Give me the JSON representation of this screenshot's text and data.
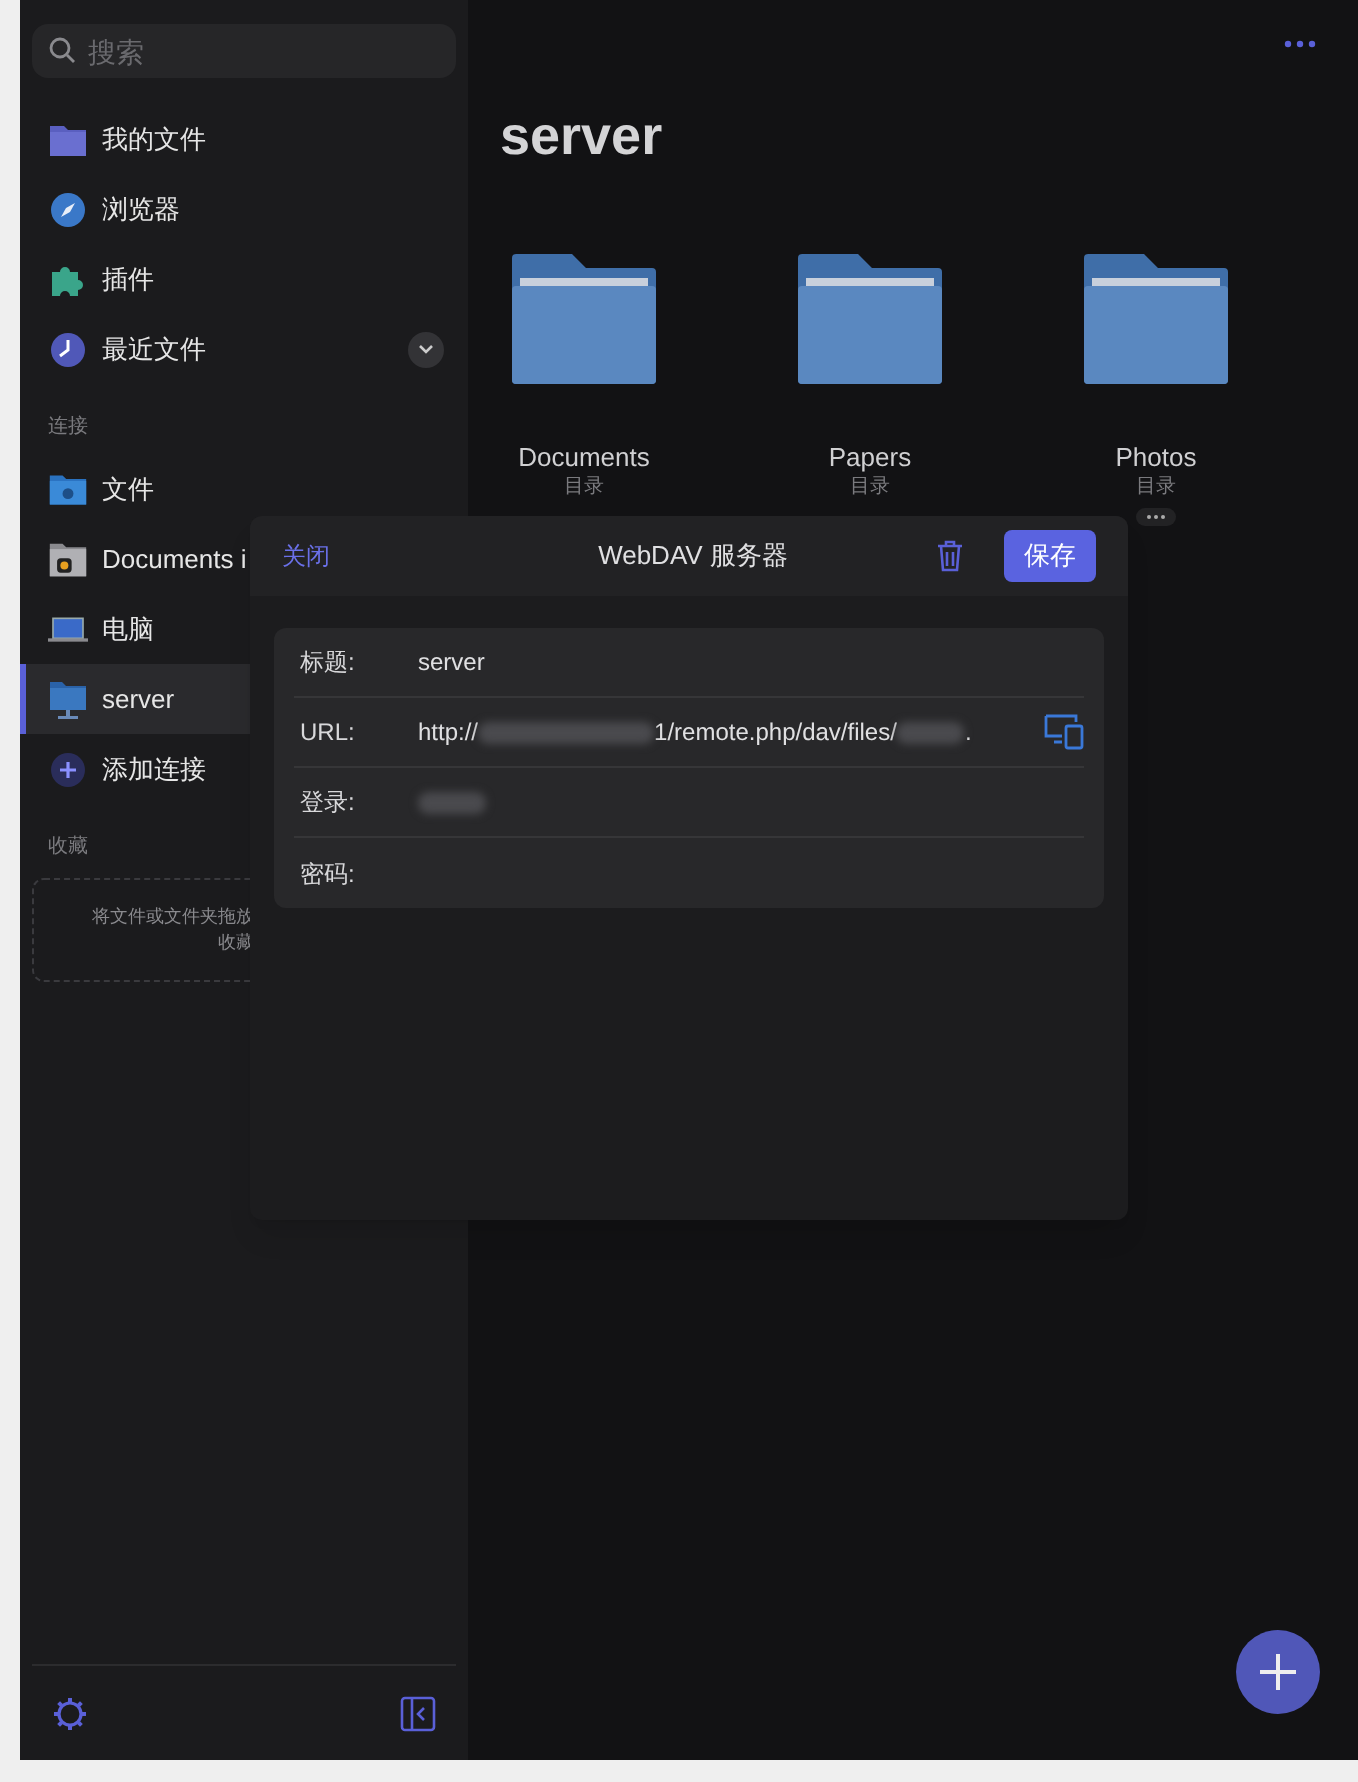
{
  "sidebar": {
    "search": {
      "placeholder": "搜索"
    },
    "items": [
      {
        "label": "我的文件",
        "kind": "folder",
        "selected": false
      },
      {
        "label": "浏览器",
        "kind": "compass",
        "selected": false
      },
      {
        "label": "插件",
        "kind": "puzzle",
        "selected": false
      },
      {
        "label": "最近文件",
        "kind": "clock",
        "selected": false,
        "expandable": true
      }
    ],
    "sections": [
      {
        "title": "连接",
        "items": [
          {
            "label": "文件",
            "kind": "apple",
            "selected": false
          },
          {
            "label": "Documents i",
            "kind": "docs",
            "selected": false
          },
          {
            "label": "电脑",
            "kind": "laptop",
            "selected": false
          },
          {
            "label": "server",
            "kind": "server",
            "selected": true
          },
          {
            "label": "添加连接",
            "kind": "add",
            "selected": false
          }
        ]
      },
      {
        "title": "收藏",
        "dropzone": [
          "将文件或文件夹拖放",
          "收藏"
        ]
      }
    ]
  },
  "main": {
    "title": "server",
    "folders": [
      {
        "name": "Documents",
        "subtitle": "目录",
        "more": false
      },
      {
        "name": "Papers",
        "subtitle": "目录",
        "more": false
      },
      {
        "name": "Photos",
        "subtitle": "目录",
        "more": true
      }
    ]
  },
  "dialog": {
    "close": "关闭",
    "title": "WebDAV 服务器",
    "save": "保存",
    "fields": [
      {
        "label": "标题:",
        "parts": [
          {
            "kind": "text",
            "text": "server"
          }
        ]
      },
      {
        "label": "URL:",
        "parts": [
          {
            "kind": "text",
            "text": "http://"
          },
          {
            "kind": "redacted"
          },
          {
            "kind": "text",
            "text": "1/remote.php/dav/files/"
          },
          {
            "kind": "redacted"
          },
          {
            "kind": "text",
            "text": "."
          }
        ],
        "device_button": true
      },
      {
        "label": "登录:",
        "parts": [
          {
            "kind": "redacted"
          }
        ]
      },
      {
        "label": "密码:"
      }
    ]
  }
}
